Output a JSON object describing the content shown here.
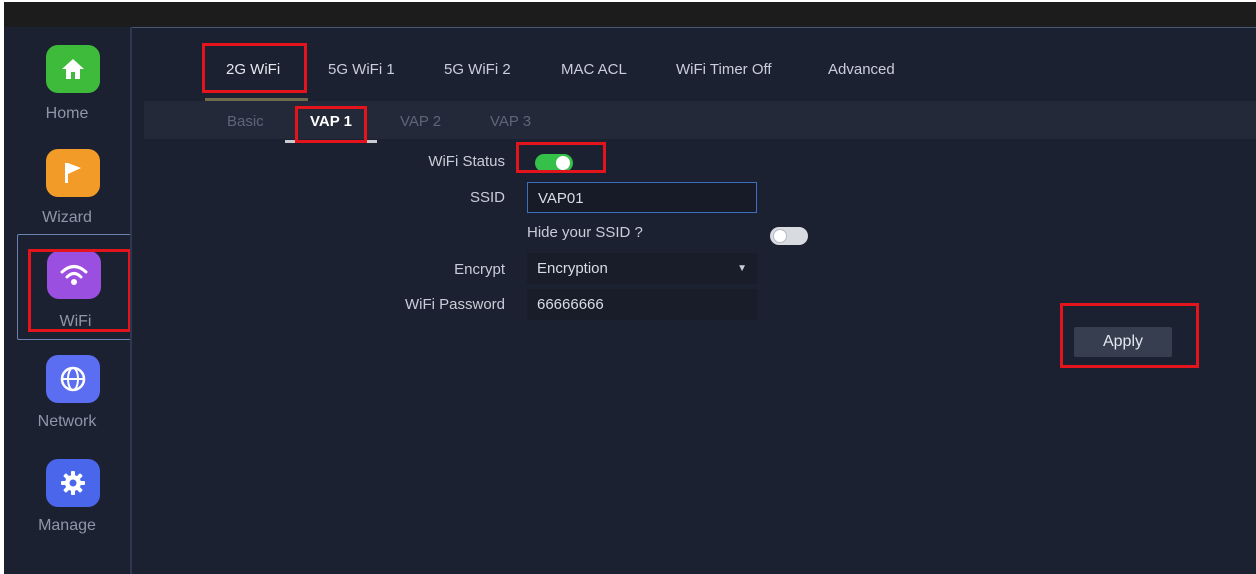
{
  "sidebar": {
    "items": [
      {
        "label": "Home",
        "icon": "home-icon",
        "color": "#3ebb3a"
      },
      {
        "label": "Wizard",
        "icon": "flag-icon",
        "color": "#f39b28"
      },
      {
        "label": "WiFi",
        "icon": "wifi-icon",
        "color": "#9b4fe0"
      },
      {
        "label": "Network",
        "icon": "globe-icon",
        "color": "#5b6df0"
      },
      {
        "label": "Manage",
        "icon": "gear-icon",
        "color": "#4a67ec"
      }
    ]
  },
  "main_tabs": [
    "2G WiFi",
    "5G WiFi 1",
    "5G WiFi 2",
    "MAC ACL",
    "WiFi Timer Off",
    "Advanced"
  ],
  "active_main_tab": "2G WiFi",
  "sub_tabs": [
    "Basic",
    "VAP 1",
    "VAP 2",
    "VAP 3"
  ],
  "active_sub_tab": "VAP 1",
  "form": {
    "wifi_status_label": "WiFi Status",
    "wifi_status_on": true,
    "ssid_label": "SSID",
    "ssid_value": "VAP01",
    "hide_ssid_label": "Hide your SSID ?",
    "hide_ssid_on": false,
    "encrypt_label": "Encrypt",
    "encrypt_value": "Encryption",
    "password_label": "WiFi Password",
    "password_value": "66666666"
  },
  "apply_label": "Apply",
  "colors": {
    "highlight": "#e3141b",
    "toggle_on": "#35c04a",
    "toggle_off": "#d8dbe0"
  }
}
